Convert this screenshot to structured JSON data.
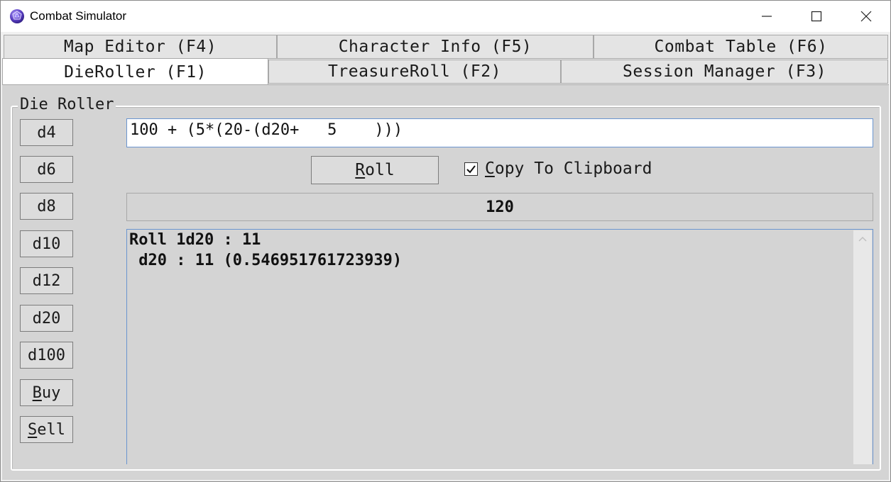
{
  "window": {
    "title": "Combat Simulator",
    "minimize_glyph": "—",
    "maximize_glyph": "☐",
    "close_glyph": "✕"
  },
  "tabs_top": [
    {
      "label": "Map Editor (F4)"
    },
    {
      "label": "Character Info (F5)"
    },
    {
      "label": "Combat Table (F6)"
    }
  ],
  "tabs_bottom": [
    {
      "label": "DieRoller (F1)",
      "active": true
    },
    {
      "label": "TreasureRoll (F2)"
    },
    {
      "label": "Session Manager (F3)"
    }
  ],
  "die_roller": {
    "group_label": "Die Roller",
    "dice": [
      {
        "label": "d4"
      },
      {
        "label": "d6"
      },
      {
        "label": "d8"
      },
      {
        "label": "d10"
      },
      {
        "label": "d12"
      },
      {
        "label": "d20"
      },
      {
        "label": "d100"
      }
    ],
    "buy": {
      "accel": "B",
      "rest": "uy"
    },
    "sell": {
      "accel": "S",
      "rest": "ell"
    },
    "expression": "100 + (5*(20-(d20+   5    )))",
    "roll": {
      "accel": "R",
      "rest": "oll"
    },
    "copy_to_clipboard": {
      "accel": "C",
      "rest": "opy To Clipboard",
      "checked": true
    },
    "result": "120",
    "log": [
      "Roll 1d20 : 11",
      " d20 : 11 (0.546951761723939)"
    ]
  },
  "colors": {
    "panel_bg": "#d4d4d4",
    "focus_border": "#6a95d0",
    "icon_purple": "#5b3fc4"
  }
}
